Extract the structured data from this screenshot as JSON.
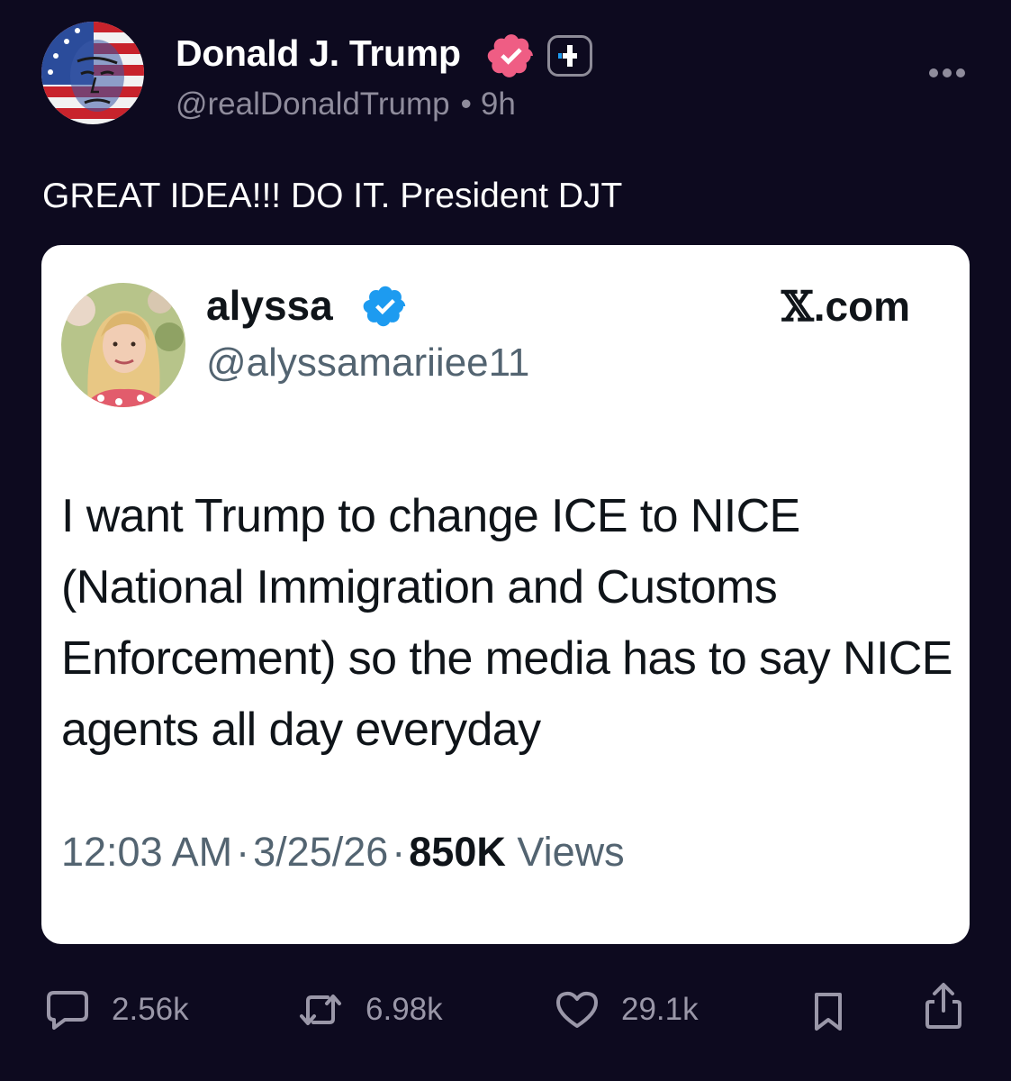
{
  "author": {
    "name": "Donald J. Trump",
    "handle": "@realDonaldTrump",
    "separator": "•",
    "time": "9h"
  },
  "post": {
    "text": "GREAT IDEA!!! DO IT. President DJT"
  },
  "quoted": {
    "name": "alyssa",
    "handle": "@alyssamariiee11",
    "source_glyph": "𝕏",
    "source_suffix": ".com",
    "text": "I want Trump to change ICE to NICE (National Immigration and Customs Enforcement) so the media has to say NICE agents all day everyday",
    "time": "12:03 AM",
    "separator": "·",
    "date": "3/25/26",
    "views_count": "850K",
    "views_label": "Views"
  },
  "actions": {
    "replies": "2.56k",
    "reposts": "6.98k",
    "likes": "29.1k"
  },
  "colors": {
    "background": "#0d0a1f",
    "verified_pink": "#ef5d84",
    "verified_blue": "#1d9bf0",
    "muted": "#8f8c9c"
  },
  "icons": {
    "verified": "verified-badge-icon",
    "plus": "plus-badge-icon",
    "more": "more-dots-icon",
    "reply": "reply-bubble-icon",
    "repost": "repost-arrows-icon",
    "like": "heart-icon",
    "bookmark": "bookmark-icon",
    "share": "share-icon"
  }
}
